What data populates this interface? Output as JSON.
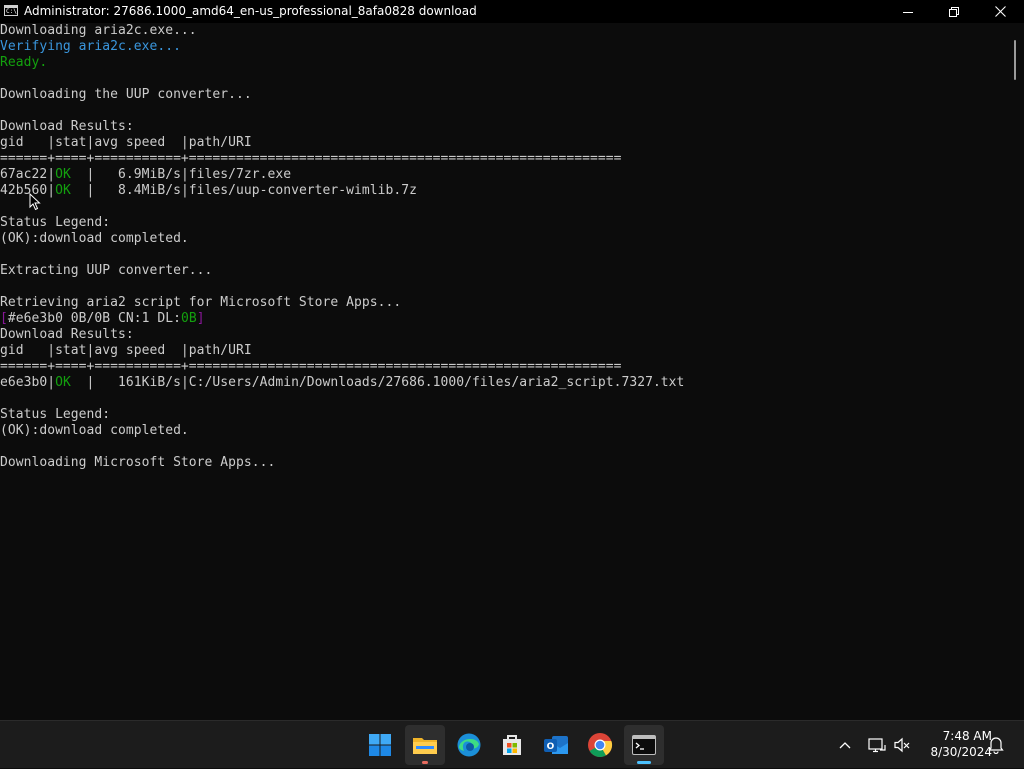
{
  "window": {
    "title": "Administrator:  27686.1000_amd64_en-us_professional_8afa0828 download",
    "icon": "cmd-icon",
    "controls": [
      "minimize-icon",
      "maximize-icon",
      "close-icon"
    ]
  },
  "colors": {
    "background": "#0c0c0c",
    "text": "#cccccc",
    "cyan": "#3a96dd",
    "green": "#13a10e",
    "magenta": "#881798",
    "taskbar": "#1c1c1c",
    "active_indicator": "#4cc2ff"
  },
  "console": {
    "l1": "Downloading aria2c.exe...",
    "l2": "Verifying aria2c.exe...",
    "l3": "Ready.",
    "l4": "",
    "l5": "Downloading the UUP converter...",
    "l6": "",
    "l7": "Download Results:",
    "l8": "gid   |stat|avg speed  |path/URI",
    "l9": "======+====+===========+=======================================================",
    "l10": {
      "gid": "67ac22|",
      "stat": "OK",
      "rest": "  |   6.9MiB/s|files/7zr.exe"
    },
    "l11": {
      "gid": "42b560|",
      "stat": "OK",
      "rest": "  |   8.4MiB/s|files/uup-converter-wimlib.7z"
    },
    "l12": "",
    "l13": "Status Legend:",
    "l14": "(OK):download completed.",
    "l15": "",
    "l16": "Extracting UUP converter...",
    "l17": "",
    "l18": "Retrieving aria2 script for Microsoft Store Apps...",
    "l19": {
      "open": "[",
      "body": "#e6e3b0 0B/0B CN:1 DL:",
      "dl": "0B",
      "close": "]"
    },
    "l20": "Download Results:",
    "l21": "gid   |stat|avg speed  |path/URI",
    "l22": "======+====+===========+=======================================================",
    "l23": {
      "gid": "e6e3b0|",
      "stat": "OK",
      "rest": "  |   161KiB/s|C:/Users/Admin/Downloads/27686.1000/files/aria2_script.7327.txt"
    },
    "l24": "",
    "l25": "Status Legend:",
    "l26": "(OK):download completed.",
    "l27": "",
    "l28": "Downloading Microsoft Store Apps..."
  },
  "taskbar": {
    "apps": [
      {
        "name": "start-icon",
        "active": false
      },
      {
        "name": "file-explorer-icon",
        "active": false,
        "running": true
      },
      {
        "name": "edge-icon",
        "active": false
      },
      {
        "name": "microsoft-store-icon",
        "active": false
      },
      {
        "name": "outlook-icon",
        "active": false
      },
      {
        "name": "chrome-icon",
        "active": false
      },
      {
        "name": "terminal-icon",
        "active": true,
        "running": true
      }
    ],
    "tray": [
      "chevron-up-icon",
      "network-icon",
      "volume-muted-icon",
      "notification-bell-icon"
    ],
    "time": "7:48 AM",
    "date": "8/30/2024"
  }
}
